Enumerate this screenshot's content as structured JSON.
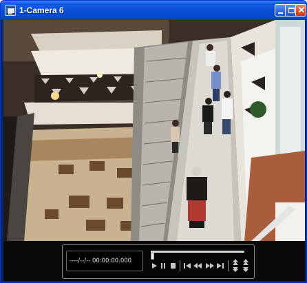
{
  "window": {
    "title": "1-Camera 6",
    "buttons": {
      "minimize": "minimize-icon",
      "maximize": "maximize-icon",
      "close": "close-icon"
    }
  },
  "video": {
    "description_icon": "camera-feed",
    "scene": "shopping-mall-escalators"
  },
  "player": {
    "timestamp": "----/--/-- 00:00:00.000",
    "seek_position": 0.0,
    "controls": [
      "play-icon",
      "pause-icon",
      "stop-icon",
      "skip-to-start-icon",
      "rewind-icon",
      "fast-forward-icon",
      "skip-to-end-icon",
      "speed-up-icon",
      "speed-down-icon"
    ]
  },
  "colors": {
    "titlebar": "#0a4fd8",
    "close_button": "#d65132",
    "control_background": "#0a0a0a"
  }
}
